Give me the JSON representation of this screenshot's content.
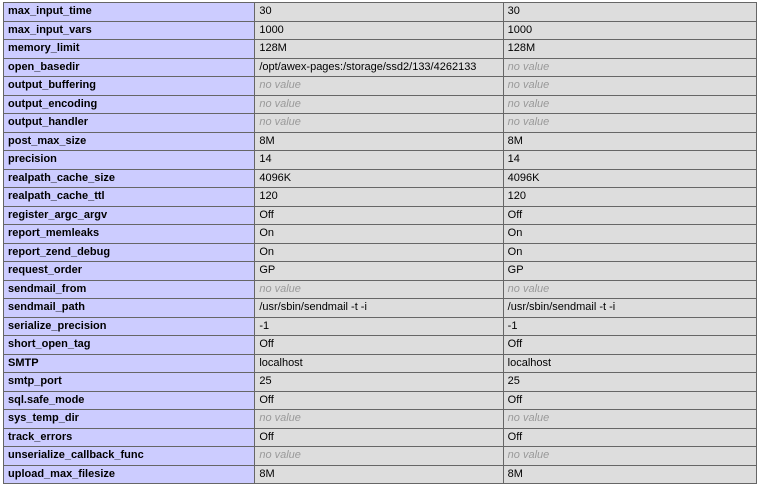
{
  "rows": [
    {
      "directive": "max_input_time",
      "local": "30",
      "master": "30"
    },
    {
      "directive": "max_input_vars",
      "local": "1000",
      "master": "1000"
    },
    {
      "directive": "memory_limit",
      "local": "128M",
      "master": "128M"
    },
    {
      "directive": "open_basedir",
      "local": "/opt/awex-pages:/storage/ssd2/133/4262133",
      "master": "no value"
    },
    {
      "directive": "output_buffering",
      "local": "no value",
      "master": "no value"
    },
    {
      "directive": "output_encoding",
      "local": "no value",
      "master": "no value"
    },
    {
      "directive": "output_handler",
      "local": "no value",
      "master": "no value"
    },
    {
      "directive": "post_max_size",
      "local": "8M",
      "master": "8M"
    },
    {
      "directive": "precision",
      "local": "14",
      "master": "14"
    },
    {
      "directive": "realpath_cache_size",
      "local": "4096K",
      "master": "4096K"
    },
    {
      "directive": "realpath_cache_ttl",
      "local": "120",
      "master": "120"
    },
    {
      "directive": "register_argc_argv",
      "local": "Off",
      "master": "Off"
    },
    {
      "directive": "report_memleaks",
      "local": "On",
      "master": "On"
    },
    {
      "directive": "report_zend_debug",
      "local": "On",
      "master": "On"
    },
    {
      "directive": "request_order",
      "local": "GP",
      "master": "GP"
    },
    {
      "directive": "sendmail_from",
      "local": "no value",
      "master": "no value"
    },
    {
      "directive": "sendmail_path",
      "local": "/usr/sbin/sendmail -t -i",
      "master": "/usr/sbin/sendmail -t -i"
    },
    {
      "directive": "serialize_precision",
      "local": "-1",
      "master": "-1"
    },
    {
      "directive": "short_open_tag",
      "local": "Off",
      "master": "Off"
    },
    {
      "directive": "SMTP",
      "local": "localhost",
      "master": "localhost"
    },
    {
      "directive": "smtp_port",
      "local": "25",
      "master": "25"
    },
    {
      "directive": "sql.safe_mode",
      "local": "Off",
      "master": "Off"
    },
    {
      "directive": "sys_temp_dir",
      "local": "no value",
      "master": "no value"
    },
    {
      "directive": "track_errors",
      "local": "Off",
      "master": "Off"
    },
    {
      "directive": "unserialize_callback_func",
      "local": "no value",
      "master": "no value"
    },
    {
      "directive": "upload_max_filesize",
      "local": "8M",
      "master": "8M"
    }
  ],
  "colors": {
    "directive_bg": "#ccccff",
    "value_bg": "#dddddd",
    "border": "#666666",
    "no_value_text": "#999999"
  }
}
